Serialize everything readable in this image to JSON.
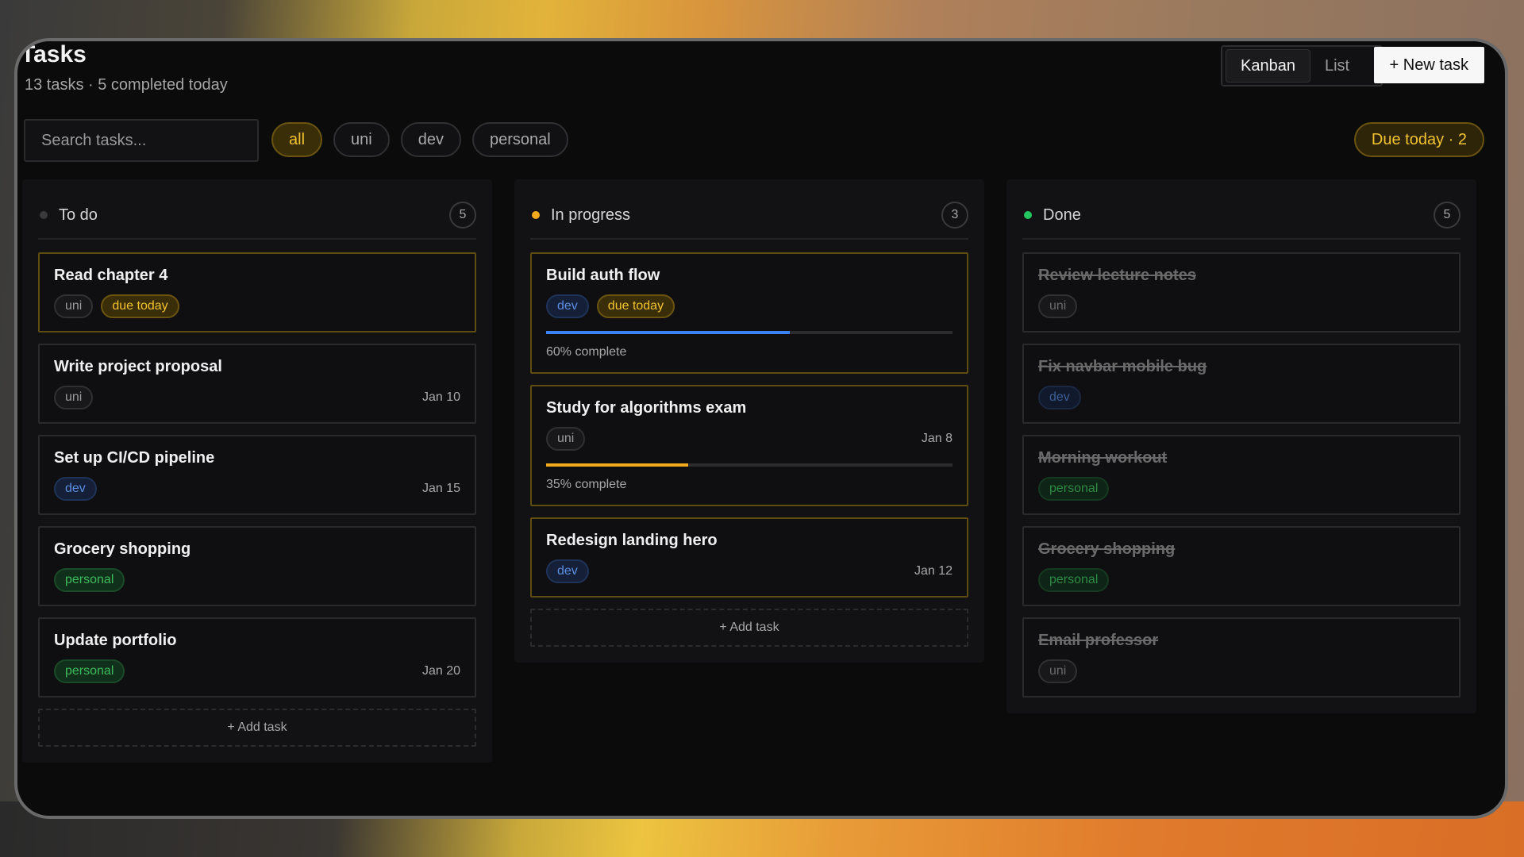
{
  "header": {
    "title": "Tasks",
    "subtitle": "13 tasks · 5 completed today",
    "views": [
      "Kanban",
      "List"
    ],
    "active_view": "Kanban",
    "new_task_label": "+ New task"
  },
  "search": {
    "placeholder": "Search tasks..."
  },
  "filters": [
    "all",
    "uni",
    "dev",
    "personal"
  ],
  "active_filter": "all",
  "due_pill": "Due today · 2",
  "add_task_label": "+ Add task",
  "colors": {
    "accent": "#f2c230",
    "todo_dot": "#3a3a3c",
    "progress_dot": "#f2a91c",
    "done_dot": "#22c55e",
    "progress_blue": "#3b82f6",
    "progress_orange": "#f2a91c"
  },
  "columns": [
    {
      "title": "To do",
      "count": "5",
      "cards": [
        {
          "title": "Read chapter 4",
          "tag": "uni",
          "due": "due today",
          "date": ""
        },
        {
          "title": "Write project proposal",
          "tag": "uni",
          "due": "",
          "date": "Jan 10"
        },
        {
          "title": "Set up CI/CD pipeline",
          "tag": "dev",
          "due": "",
          "date": "Jan 15"
        },
        {
          "title": "Grocery shopping",
          "tag": "personal",
          "due": "",
          "date": ""
        },
        {
          "title": "Update portfolio",
          "tag": "personal",
          "due": "",
          "date": "Jan 20"
        }
      ]
    },
    {
      "title": "In progress",
      "count": "3",
      "cards": [
        {
          "title": "Build auth flow",
          "tag": "dev",
          "due": "due today",
          "date": "",
          "progress": 0.6,
          "progress_label": "60% complete"
        },
        {
          "title": "Study for algorithms exam",
          "tag": "uni",
          "due": "",
          "date": "Jan 8",
          "progress": 0.35,
          "progress_label": "35% complete"
        },
        {
          "title": "Redesign landing hero",
          "tag": "dev",
          "due": "",
          "date": "Jan 12"
        }
      ]
    },
    {
      "title": "Done",
      "count": "5",
      "cards": [
        {
          "title": "Review lecture notes",
          "tag": "uni"
        },
        {
          "title": "Fix navbar mobile bug",
          "tag": "dev"
        },
        {
          "title": "Morning workout",
          "tag": "personal"
        },
        {
          "title": "Grocery shopping",
          "tag": "personal"
        },
        {
          "title": "Email professor",
          "tag": "uni"
        }
      ]
    }
  ]
}
